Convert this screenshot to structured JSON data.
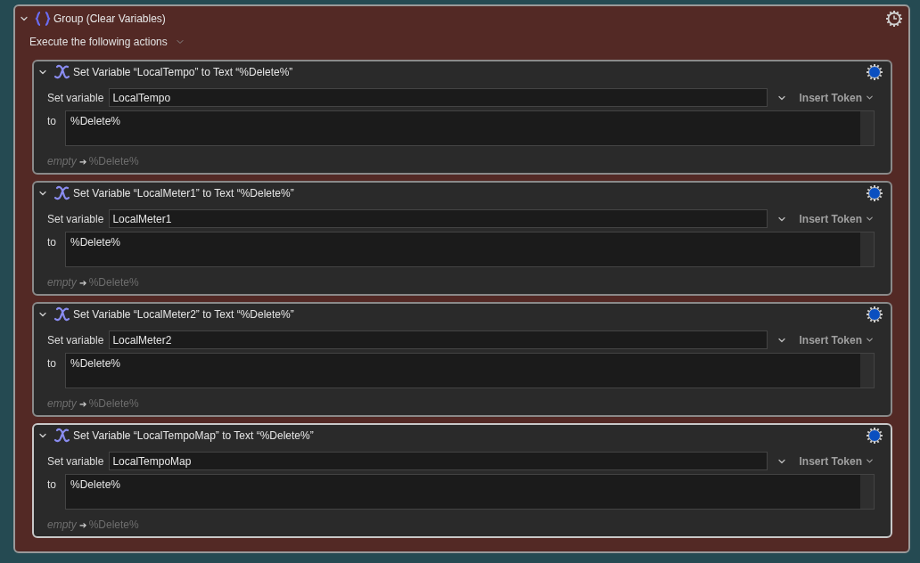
{
  "group": {
    "title": "Group (Clear Variables)",
    "expanded": true,
    "execute_label": "Execute the following actions",
    "actions": [
      {
        "title": "Set Variable “LocalTempo” to Text “%Delete%”",
        "expanded": true,
        "selected": false,
        "variable_label": "Set variable",
        "variable": "LocalTempo",
        "insert_token": "Insert Token",
        "to_label": "to",
        "text": "%Delete%",
        "preview_from": "empty",
        "preview_arrow": "➔",
        "preview_to": "%Delete%"
      },
      {
        "title": "Set Variable “LocalMeter1” to Text “%Delete%”",
        "expanded": true,
        "selected": false,
        "variable_label": "Set variable",
        "variable": "LocalMeter1",
        "insert_token": "Insert Token",
        "to_label": "to",
        "text": "%Delete%",
        "preview_from": "empty",
        "preview_arrow": "➔",
        "preview_to": "%Delete%"
      },
      {
        "title": "Set Variable “LocalMeter2” to Text “%Delete%”",
        "expanded": true,
        "selected": false,
        "variable_label": "Set variable",
        "variable": "LocalMeter2",
        "insert_token": "Insert Token",
        "to_label": "to",
        "text": "%Delete%",
        "preview_from": "empty",
        "preview_arrow": "➔",
        "preview_to": "%Delete%"
      },
      {
        "title": "Set Variable “LocalTempoMap” to Text “%Delete%”",
        "expanded": true,
        "selected": true,
        "variable_label": "Set variable",
        "variable": "LocalTempoMap",
        "insert_token": "Insert Token",
        "to_label": "to",
        "text": "%Delete%",
        "preview_from": "empty",
        "preview_arrow": "➔",
        "preview_to": "%Delete%"
      }
    ]
  }
}
